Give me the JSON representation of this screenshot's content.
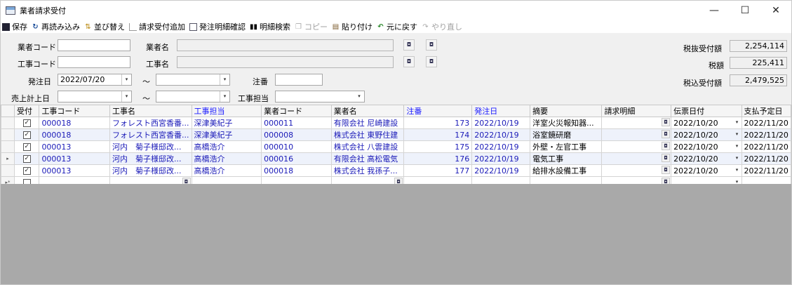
{
  "window": {
    "title": "業者請求受付",
    "minimize": "—",
    "maximize": "☐",
    "close": "✕"
  },
  "toolbar": {
    "save": "保存",
    "reload": "再読み込み",
    "sort": "並び替え",
    "add_receipt": "請求受付追加",
    "order_detail": "発注明細確認",
    "detail_search": "明細検索",
    "copy": "コピー",
    "paste": "貼り付け",
    "undo": "元に戻す",
    "redo": "やり直し"
  },
  "filters": {
    "vendor_code_label": "業者コード",
    "vendor_code": "",
    "vendor_name_label": "業者名",
    "vendor_name": "",
    "project_code_label": "工事コード",
    "project_code": "",
    "project_name_label": "工事名",
    "project_name": "",
    "order_date_label": "発注日",
    "order_date_from": "2022/07/20",
    "order_date_to": "",
    "tilde": "～",
    "order_no_label": "注番",
    "order_no": "",
    "sales_date_label": "売上計上日",
    "sales_date_from": "",
    "sales_date_to": "",
    "project_manager_label": "工事担当",
    "project_manager": ""
  },
  "totals": {
    "pretax_label": "税抜受付額",
    "pretax": "2,254,114",
    "tax_label": "税額",
    "tax": "225,411",
    "incl_label": "税込受付額",
    "incl": "2,479,525"
  },
  "grid": {
    "columns": [
      "受付",
      "工事コード",
      "工事名",
      "工事担当",
      "業者コード",
      "業者名",
      "注番",
      "発注日",
      "摘要",
      "請求明細",
      "伝票日付",
      "支払予定日"
    ],
    "rows": [
      {
        "accepted": true,
        "project_code": "000018",
        "project_name": "フォレスト西宮香番...",
        "manager": "深津美紀子",
        "vendor_code": "000011",
        "vendor_name": "有限会社 尼崎建設",
        "order_no": "173",
        "order_date": "2022/10/19",
        "summary": "洋室火災報知器...",
        "invoice": "",
        "slip_date": "2022/10/20",
        "pay_date": "2022/11/20",
        "marker": ""
      },
      {
        "accepted": true,
        "project_code": "000018",
        "project_name": "フォレスト西宮香番...",
        "manager": "深津美紀子",
        "vendor_code": "000008",
        "vendor_name": "株式会社 東野住建",
        "order_no": "174",
        "order_date": "2022/10/19",
        "summary": "浴室鏡研磨",
        "invoice": "",
        "slip_date": "2022/10/20",
        "pay_date": "2022/11/20",
        "marker": ""
      },
      {
        "accepted": true,
        "project_code": "000013",
        "project_name": "河内　菊子様邸改...",
        "manager": "高橋浩介",
        "vendor_code": "000010",
        "vendor_name": "株式会社 八雲建設",
        "order_no": "175",
        "order_date": "2022/10/19",
        "summary": "外壁・左官工事",
        "invoice": "",
        "slip_date": "2022/10/20",
        "pay_date": "2022/11/20",
        "marker": ""
      },
      {
        "accepted": true,
        "project_code": "000013",
        "project_name": "河内　菊子様邸改...",
        "manager": "高橋浩介",
        "vendor_code": "000016",
        "vendor_name": "有限会社 高松電気",
        "order_no": "176",
        "order_date": "2022/10/19",
        "summary": "電気工事",
        "invoice": "",
        "slip_date": "2022/10/20",
        "pay_date": "2022/11/20",
        "marker": "▸"
      },
      {
        "accepted": true,
        "project_code": "000013",
        "project_name": "河内　菊子様邸改...",
        "manager": "高橋浩介",
        "vendor_code": "000018",
        "vendor_name": "株式会社 我孫子...",
        "order_no": "177",
        "order_date": "2022/10/19",
        "summary": "給排水設備工事",
        "invoice": "",
        "slip_date": "2022/10/20",
        "pay_date": "2022/11/20",
        "marker": ""
      }
    ],
    "new_row_marker": "▸*"
  },
  "icons": {
    "picker": "◘",
    "dropdown": "▾",
    "check": "✓"
  }
}
